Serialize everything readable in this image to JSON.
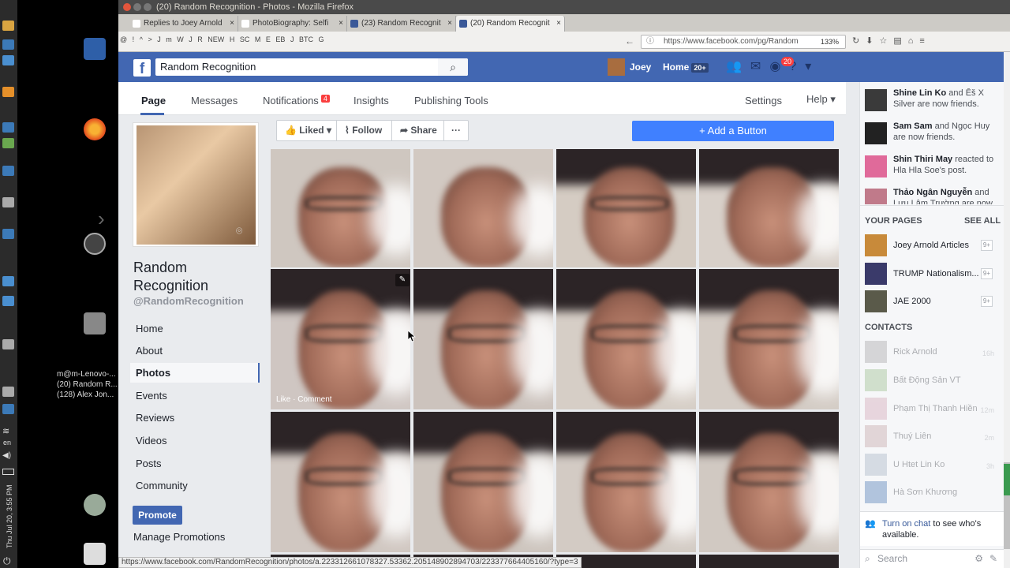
{
  "window": {
    "title": "(20) Random Recognition - Photos - Mozilla Firefox"
  },
  "tabs": [
    {
      "label": "Replies to Joey Arnold"
    },
    {
      "label": "PhotoBiography: Selfi"
    },
    {
      "label": "(23) Random Recognit"
    },
    {
      "label": "(20) Random Recognit"
    }
  ],
  "bookmarks": [
    "@",
    "!",
    "^",
    ">",
    "J",
    "m",
    "W",
    "J",
    "R",
    "NEW",
    "H",
    "SC",
    "M",
    "E",
    "EB",
    "J",
    "BTC",
    "G"
  ],
  "address": {
    "url": "https://www.facebook.com/pg/Random",
    "zoom": "133%"
  },
  "taskbar": {
    "items": [
      "m@m-Lenovo-...",
      "(20) Random R...",
      "(128) Alex Jon..."
    ],
    "clock": "Thu Jul 20, 3:55 PM",
    "lang": "en"
  },
  "fb": {
    "search_value": "Random Recognition",
    "user": "Joey",
    "home": "Home",
    "home_count": "20+",
    "notif_count": "20"
  },
  "pagetabs": {
    "page": "Page",
    "messages": "Messages",
    "notifications": "Notifications",
    "notif_badge": "4",
    "insights": "Insights",
    "publishing": "Publishing Tools",
    "settings": "Settings",
    "help": "Help ▾"
  },
  "page": {
    "name_line1": "Random",
    "name_line2": "Recognition",
    "handle": "@RandomRecognition"
  },
  "leftnav": [
    "Home",
    "About",
    "Photos",
    "Events",
    "Reviews",
    "Videos",
    "Posts",
    "Community"
  ],
  "promote": "Promote",
  "manage": "Manage Promotions",
  "actions": {
    "liked": "Liked ▾",
    "follow": "Follow",
    "share": "Share",
    "more": "···",
    "add": "+ Add a Button"
  },
  "photo_hover": "Like · Comment",
  "ticker": [
    {
      "name": "Shine Lin Ko",
      "rest": " and Ēš X Silver are now friends."
    },
    {
      "name": "Sam Sam",
      "rest": " and Ngọc Huy are now friends."
    },
    {
      "name": "Shin Thiri May",
      "rest": " reacted to Hla Hla Soe's post."
    },
    {
      "name": "Thảo Ngân Nguyễn",
      "rest": " and Lưu Lâm Trường are now"
    }
  ],
  "your_pages": {
    "heading": "YOUR PAGES",
    "see_all": "SEE ALL",
    "items": [
      {
        "name": "Joey Arnold Articles",
        "count": "9+"
      },
      {
        "name": "TRUMP Nationalism...",
        "count": "9+"
      },
      {
        "name": "JAE 2000",
        "count": "9+"
      }
    ]
  },
  "contacts": {
    "heading": "CONTACTS",
    "items": [
      {
        "name": "Rick Arnold",
        "time": "16h"
      },
      {
        "name": "Bất Động Sản VT",
        "time": ""
      },
      {
        "name": "Phạm Thị Thanh Hiền",
        "time": "12m"
      },
      {
        "name": "Thuý Liên",
        "time": "2m"
      },
      {
        "name": "U Htet Lin Ko",
        "time": "3h"
      },
      {
        "name": "Hà Sơn Khương",
        "time": ""
      }
    ]
  },
  "chat": {
    "link": "Turn on chat",
    "rest": " to see who's available.",
    "search": "Search"
  },
  "status_url": "https://www.facebook.com/RandomRecognition/photos/a.223312661078327.53362.205148902894703/223377664405160/?type=3",
  "colors": {
    "fb_blue": "#4267b2",
    "add_button": "#4080ff",
    "badge_red": "#fa3e3e"
  }
}
